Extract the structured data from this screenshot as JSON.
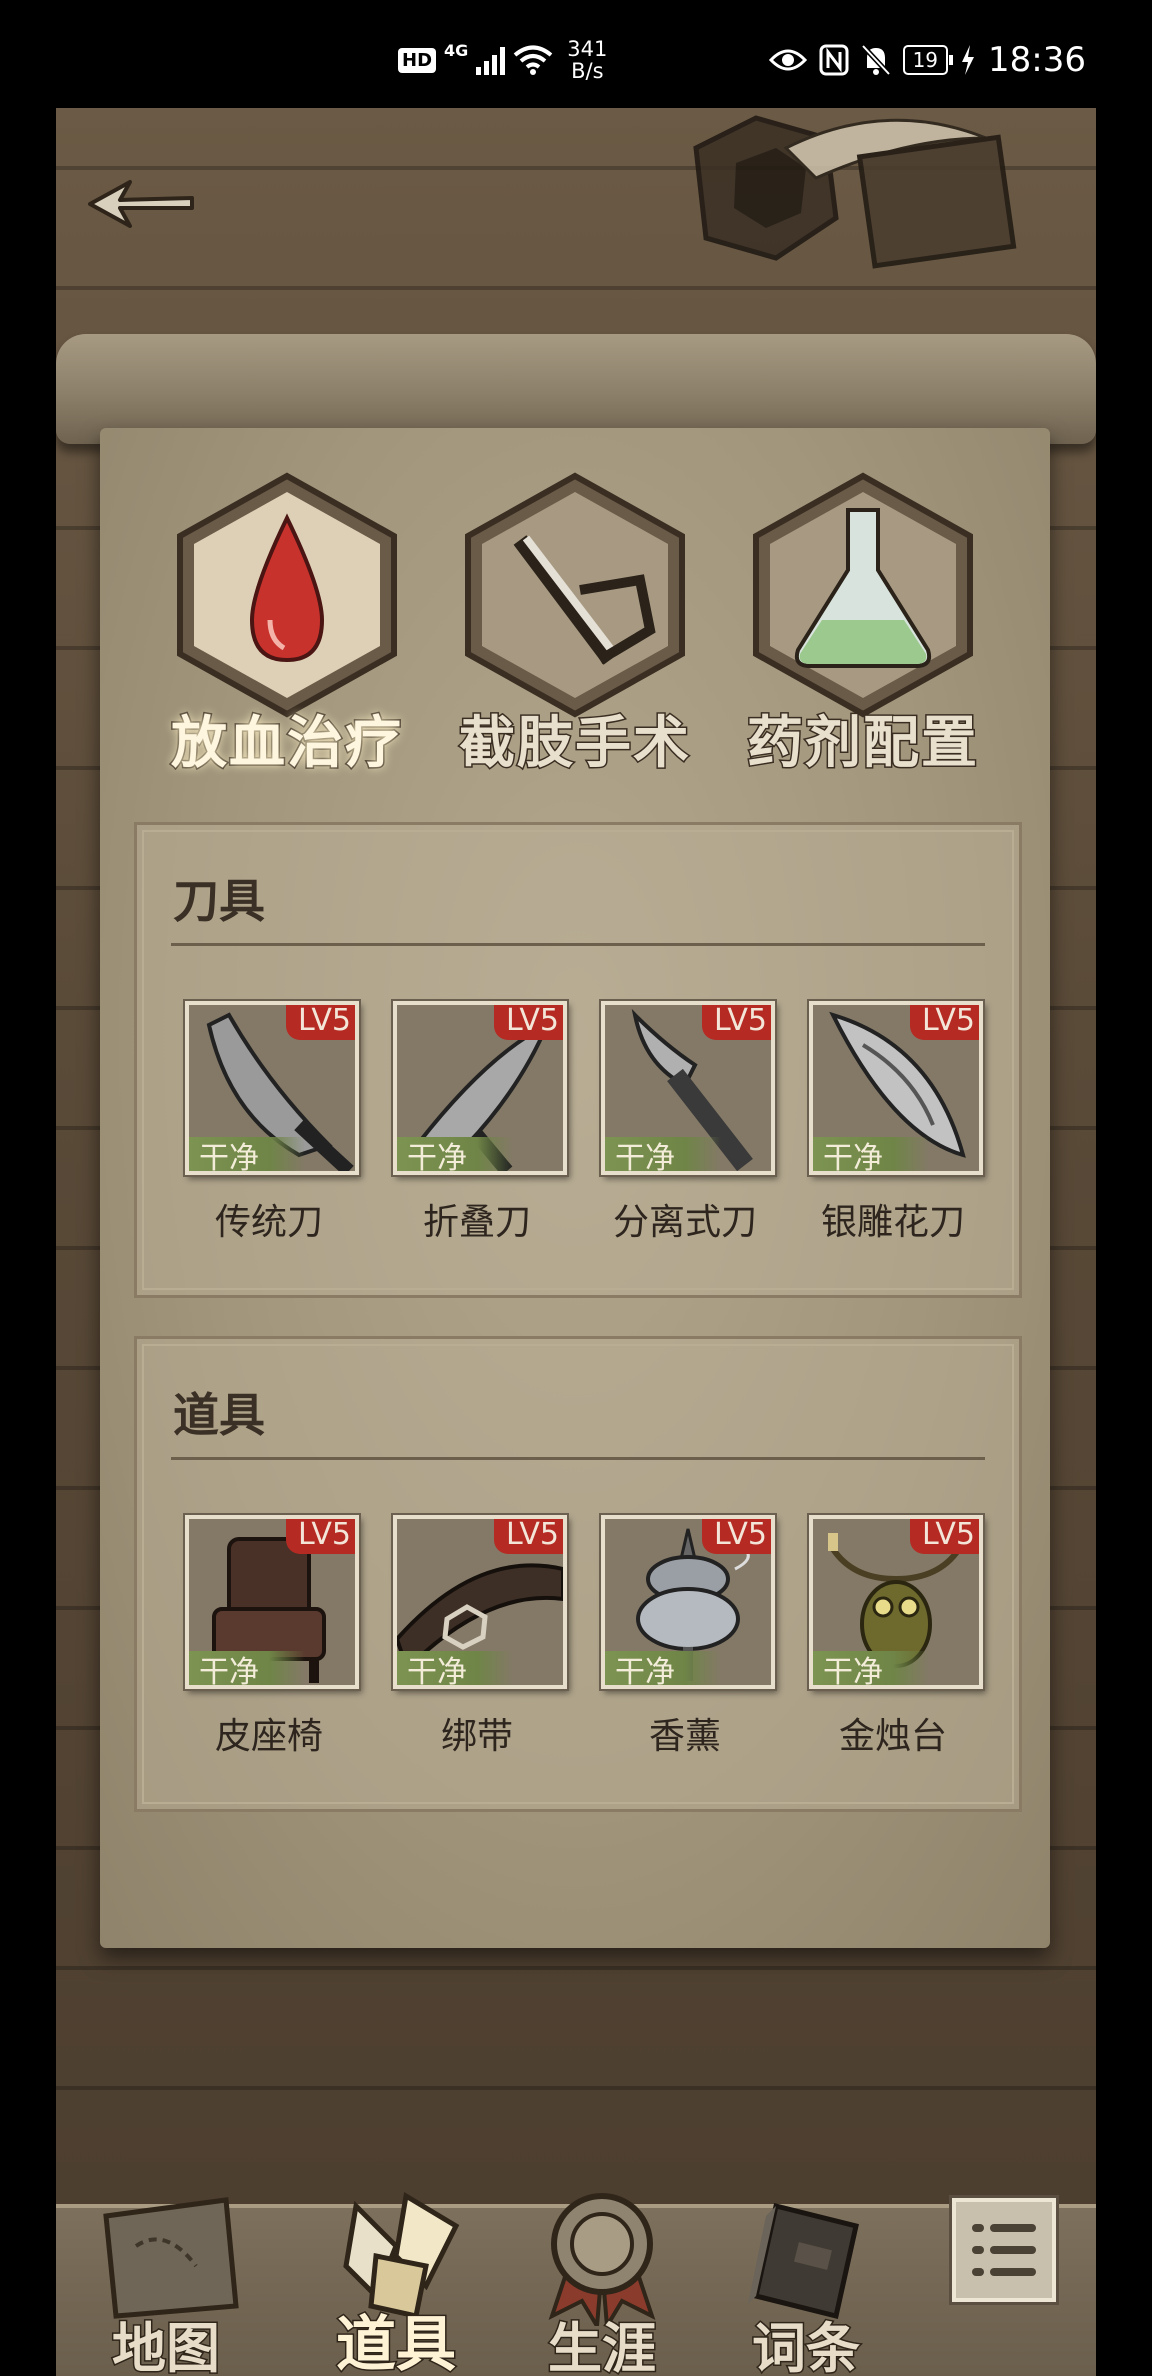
{
  "status_bar": {
    "hd": "HD",
    "network": "4G",
    "speed_value": "341",
    "speed_unit": "B/s",
    "battery": "19",
    "time": "18:36"
  },
  "tabs": [
    {
      "label": "放血治疗",
      "icon": "blood-drop-icon",
      "active": true
    },
    {
      "label": "截肢手术",
      "icon": "saw-icon",
      "active": false
    },
    {
      "label": "药剂配置",
      "icon": "flask-icon",
      "active": false
    }
  ],
  "knives": {
    "title": "刀具",
    "items": [
      {
        "name": "传统刀",
        "level": "LV5",
        "state": "干净"
      },
      {
        "name": "折叠刀",
        "level": "LV5",
        "state": "干净"
      },
      {
        "name": "分离式刀",
        "level": "LV5",
        "state": "干净"
      },
      {
        "name": "银雕花刀",
        "level": "LV5",
        "state": "干净"
      }
    ]
  },
  "tools": {
    "title": "道具",
    "items": [
      {
        "name": "皮座椅",
        "level": "LV5",
        "state": "干净"
      },
      {
        "name": "绑带",
        "level": "LV5",
        "state": "干净"
      },
      {
        "name": "香薰",
        "level": "LV5",
        "state": "干净"
      },
      {
        "name": "金烛台",
        "level": "LV5",
        "state": "干净"
      }
    ]
  },
  "bottom_nav": [
    {
      "label": "地图",
      "icon": "map-icon"
    },
    {
      "label": "道具",
      "icon": "tools-icon",
      "active": true
    },
    {
      "label": "生涯",
      "icon": "medal-icon"
    },
    {
      "label": "词条",
      "icon": "book-icon"
    }
  ],
  "colors": {
    "level_badge": "#b52a23",
    "clean_badge": "#7d9452",
    "blood": "#c8322d",
    "potion": "#9cc98e"
  }
}
